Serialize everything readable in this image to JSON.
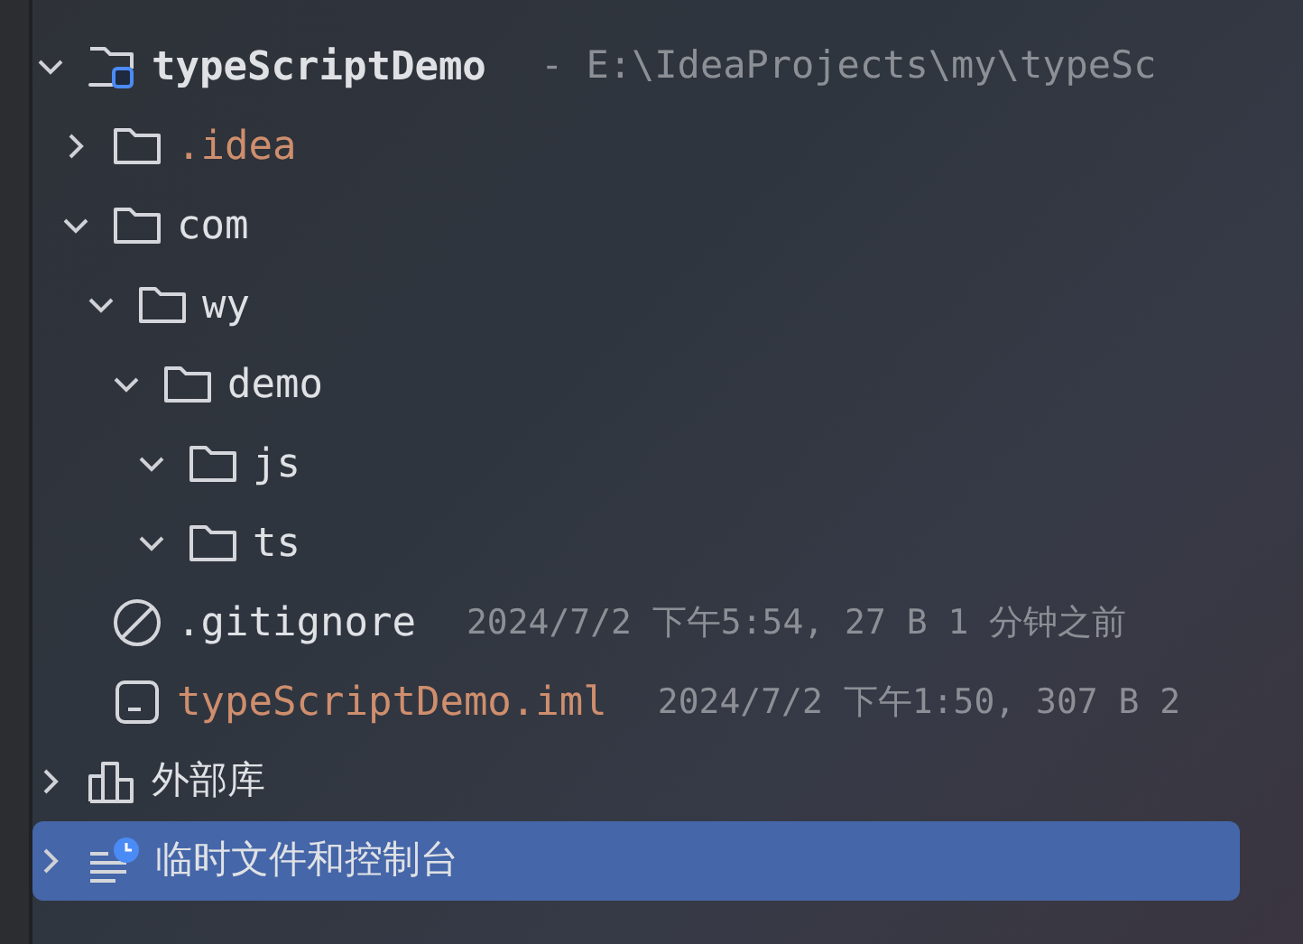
{
  "tree": [
    {
      "name": "typeScriptDemo",
      "kind": "project",
      "path": "- E:\\IdeaProjects\\my\\typeSc",
      "expanded": true,
      "selected": false,
      "excluded": false,
      "children": [
        {
          "name": ".idea",
          "kind": "folder",
          "expanded": false,
          "selected": false,
          "excluded": true
        },
        {
          "name": "com",
          "kind": "folder",
          "expanded": true,
          "selected": false,
          "excluded": false,
          "children": [
            {
              "name": "wy",
              "kind": "folder",
              "expanded": true,
              "selected": false,
              "excluded": false,
              "children": [
                {
                  "name": "demo",
                  "kind": "folder",
                  "expanded": true,
                  "selected": false,
                  "excluded": false,
                  "children": [
                    {
                      "name": "js",
                      "kind": "folder",
                      "expanded": true,
                      "selected": false,
                      "excluded": false
                    },
                    {
                      "name": "ts",
                      "kind": "folder",
                      "expanded": true,
                      "selected": false,
                      "excluded": false
                    }
                  ]
                }
              ]
            }
          ]
        },
        {
          "name": ".gitignore",
          "kind": "ignore-file",
          "details": "2024/7/2 下午5:54, 27 B 1 分钟之前",
          "selected": false,
          "excluded": false
        },
        {
          "name": "typeScriptDemo.iml",
          "kind": "module-file",
          "details": "2024/7/2 下午1:50, 307 B 2",
          "selected": false,
          "excluded": true
        }
      ]
    },
    {
      "name": "外部库",
      "kind": "library",
      "expanded": false,
      "selected": false,
      "excluded": false
    },
    {
      "name": "临时文件和控制台",
      "kind": "scratch",
      "expanded": false,
      "selected": true,
      "excluded": false
    }
  ]
}
